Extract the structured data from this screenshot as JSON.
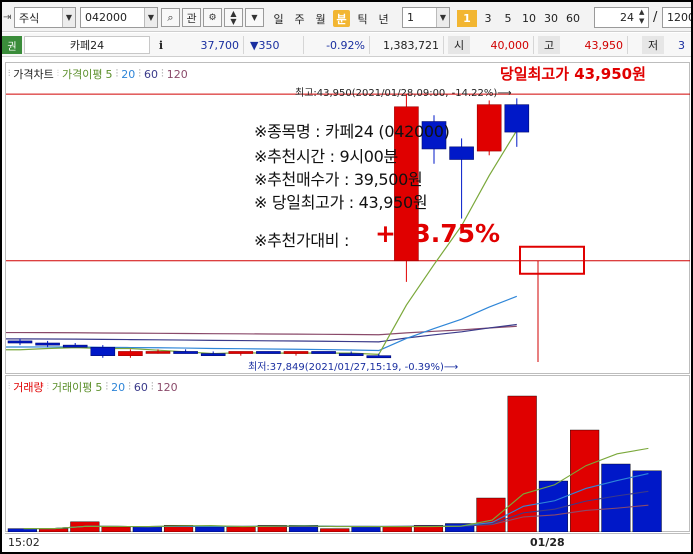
{
  "toolbar": {
    "market": "주식",
    "code": "042000",
    "btn_search": "⌕",
    "btn_related": "관",
    "periods": [
      "일",
      "주",
      "월",
      "분",
      "틱",
      "년"
    ],
    "active_period": "분",
    "interval_value": "1",
    "intervals": [
      "1",
      "3",
      "5",
      "10",
      "30",
      "60"
    ],
    "active_interval": "1",
    "count_value": "24",
    "slash": "/",
    "total_value": "1200"
  },
  "quote": {
    "prefix": "권",
    "name": "카페24",
    "info_btn": "i",
    "price": "37,700",
    "change": "▼350",
    "change_pct": "-0.92%",
    "volume": "1,383,721",
    "open_label": "시",
    "open_value": "40,000",
    "high_label": "고",
    "high_value": "43,950",
    "low_label": "저",
    "low_value": "3"
  },
  "price_panel": {
    "legend_price": "가격차트",
    "legend_ma_label": "가격이평",
    "ma_periods": [
      "5",
      "20",
      "60",
      "120"
    ],
    "high_annotation": "최고:43,950(2021/01/28,09:00, -14.22%)⟶",
    "low_annotation": "최저:37,849(2021/01/27,15:19, -0.39%)⟶",
    "headline": "당일최고가 43,950원"
  },
  "recommendation": {
    "line1": "※종목명 : 카페24 (042000)",
    "line2": "※추천시간 : 9시00분",
    "line3": "※추천매수가 : 39,500원",
    "line4": "※ 당일최고가 : 43,950원",
    "line5_label": "※추천가대비 :",
    "line5_value": "+13.75%"
  },
  "volume_panel": {
    "legend_volume": "거래량",
    "legend_ma_label": "거래이평",
    "ma_periods": [
      "5",
      "20",
      "60",
      "120"
    ]
  },
  "x_axis": {
    "left_label": "15:02",
    "mid_label": "01/28"
  },
  "colors": {
    "up": "#e00000",
    "down": "#0018c8",
    "ma5": "#7aa83a",
    "ma20": "#2f86d8",
    "ma60": "#3a3a8a",
    "ma120": "#8a4a6a",
    "accent": "#f2b632"
  },
  "chart_data": {
    "type": "candlestick",
    "candles": [
      {
        "o": 38100,
        "h": 38150,
        "l": 38000,
        "c": 38050
      },
      {
        "o": 38050,
        "h": 38100,
        "l": 37950,
        "c": 38000
      },
      {
        "o": 38000,
        "h": 38050,
        "l": 37950,
        "c": 37950
      },
      {
        "o": 37950,
        "h": 38000,
        "l": 37700,
        "c": 37750
      },
      {
        "o": 37750,
        "h": 37900,
        "l": 37700,
        "c": 37850
      },
      {
        "o": 37850,
        "h": 37900,
        "l": 37800,
        "c": 37850
      },
      {
        "o": 37850,
        "h": 37900,
        "l": 37800,
        "c": 37800
      },
      {
        "o": 37800,
        "h": 37850,
        "l": 37750,
        "c": 37750
      },
      {
        "o": 37800,
        "h": 37850,
        "l": 37750,
        "c": 37850
      },
      {
        "o": 37850,
        "h": 37850,
        "l": 37800,
        "c": 37800
      },
      {
        "o": 37800,
        "h": 37850,
        "l": 37750,
        "c": 37850
      },
      {
        "o": 37850,
        "h": 37850,
        "l": 37800,
        "c": 37800
      },
      {
        "o": 37800,
        "h": 37850,
        "l": 37750,
        "c": 37750
      },
      {
        "o": 37750,
        "h": 37800,
        "l": 37700,
        "c": 37700
      },
      {
        "o": 40000,
        "h": 43950,
        "l": 39500,
        "c": 43650
      },
      {
        "o": 43300,
        "h": 43450,
        "l": 42300,
        "c": 42650
      },
      {
        "o": 42700,
        "h": 42900,
        "l": 41000,
        "c": 42400
      },
      {
        "o": 42600,
        "h": 43800,
        "l": 42500,
        "c": 43700
      },
      {
        "o": 43700,
        "h": 43850,
        "l": 42700,
        "c": 43050
      }
    ],
    "volume": [
      2,
      2,
      6,
      3,
      3,
      4,
      3,
      3,
      4,
      4,
      2,
      3,
      3,
      4,
      5,
      20,
      80,
      30,
      60,
      40,
      36
    ],
    "volume_colors": [
      "down",
      "up",
      "up",
      "up",
      "down",
      "up",
      "down",
      "up",
      "up",
      "down",
      "up",
      "down",
      "up",
      "up",
      "down",
      "up",
      "up",
      "down",
      "up",
      "down",
      "down"
    ],
    "ylim": [
      37600,
      44000
    ]
  }
}
